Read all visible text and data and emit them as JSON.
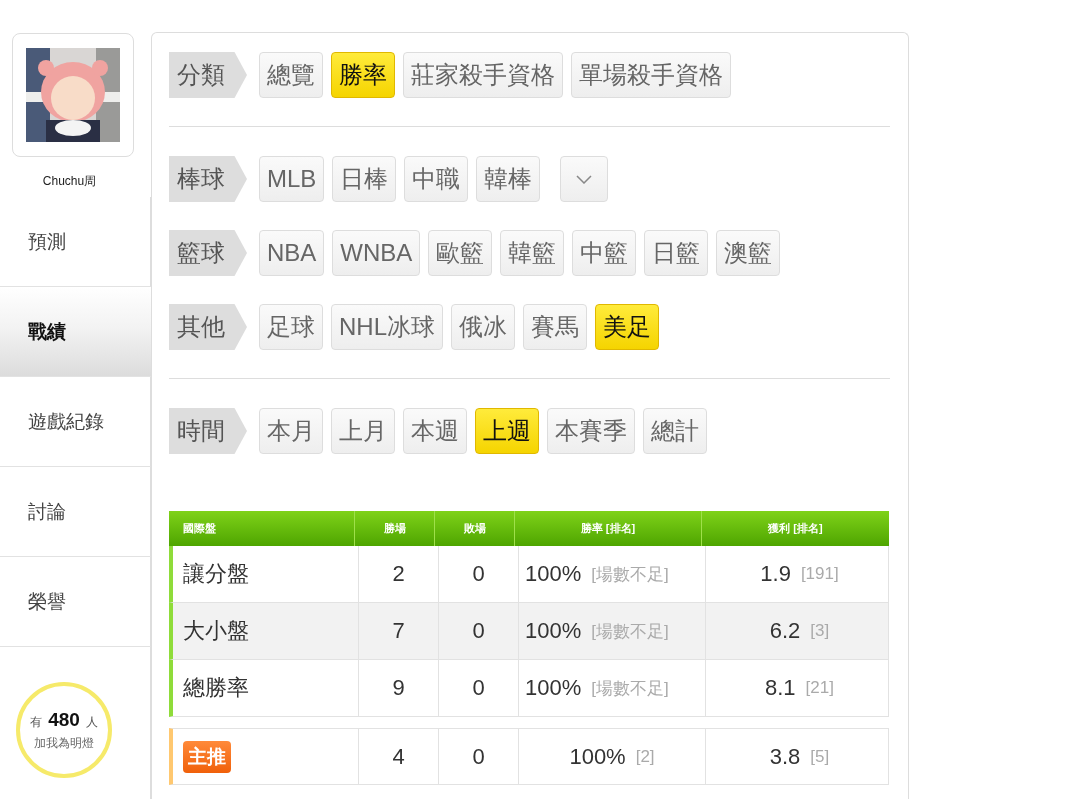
{
  "sidebar": {
    "user_name": "Chuchu周",
    "nav_items": [
      {
        "label": "預測",
        "selected": false
      },
      {
        "label": "戰績",
        "selected": true
      },
      {
        "label": "遊戲紀錄",
        "selected": false
      },
      {
        "label": "討論",
        "selected": false
      },
      {
        "label": "榮譽",
        "selected": false
      }
    ],
    "fans": {
      "count_text": "有 **480** 人",
      "caption": "加我為明燈"
    }
  },
  "filter_groups": [
    {
      "rows": [
        {
          "label": "分類",
          "options": [
            {
              "label": "總覽",
              "selected": false
            },
            {
              "label": "勝率",
              "selected": true
            },
            {
              "label": "莊家殺手資格",
              "selected": false
            },
            {
              "label": "單場殺手資格",
              "selected": false
            }
          ]
        }
      ]
    },
    {
      "rows": [
        {
          "label": "棒球",
          "more_button": true,
          "options": [
            {
              "label": "MLB",
              "selected": false
            },
            {
              "label": "日棒",
              "selected": false
            },
            {
              "label": "中職",
              "selected": false
            },
            {
              "label": "韓棒",
              "selected": false
            }
          ]
        },
        {
          "label": "籃球",
          "options": [
            {
              "label": "NBA",
              "selected": false
            },
            {
              "label": "WNBA",
              "selected": false
            },
            {
              "label": "歐籃",
              "selected": false
            },
            {
              "label": "韓籃",
              "selected": false
            },
            {
              "label": "中籃",
              "selected": false
            },
            {
              "label": "日籃",
              "selected": false
            },
            {
              "label": "澳籃",
              "selected": false
            }
          ]
        },
        {
          "label": "其他",
          "options": [
            {
              "label": "足球",
              "selected": false
            },
            {
              "label": "NHL冰球",
              "selected": false
            },
            {
              "label": "俄冰",
              "selected": false
            },
            {
              "label": "賽馬",
              "selected": false
            },
            {
              "label": "美足",
              "selected": true
            }
          ]
        }
      ]
    },
    {
      "rows": [
        {
          "label": "時間",
          "options": [
            {
              "label": "本月",
              "selected": false
            },
            {
              "label": "上月",
              "selected": false
            },
            {
              "label": "本週",
              "selected": false
            },
            {
              "label": "上週",
              "selected": true
            },
            {
              "label": "本賽季",
              "selected": false
            },
            {
              "label": "總計",
              "selected": false
            }
          ]
        }
      ]
    }
  ],
  "table": {
    "columns": [
      "國際盤",
      "勝場",
      "敗場",
      "勝率 [排名]",
      "獲利 [排名]"
    ],
    "rows": [
      {
        "kind": "standard",
        "name": "讓分盤",
        "wins": "2",
        "losses": "0",
        "rate": "100%",
        "rate_rank": "[場數不足]",
        "profit": "1.9",
        "profit_rank": "[191]"
      },
      {
        "kind": "standard",
        "name": "大小盤",
        "wins": "7",
        "losses": "0",
        "rate": "100%",
        "rate_rank": "[場數不足]",
        "profit": "6.2",
        "profit_rank": "[3]"
      },
      {
        "kind": "standard",
        "name": "總勝率",
        "wins": "9",
        "losses": "0",
        "rate": "100%",
        "rate_rank": "[場數不足]",
        "profit": "8.1",
        "profit_rank": "[21]"
      },
      {
        "kind": "featured",
        "name": "主推",
        "wins": "4",
        "losses": "0",
        "rate": "100%",
        "rate_rank": "[2]",
        "profit": "3.8",
        "profit_rank": "[5]"
      }
    ]
  }
}
